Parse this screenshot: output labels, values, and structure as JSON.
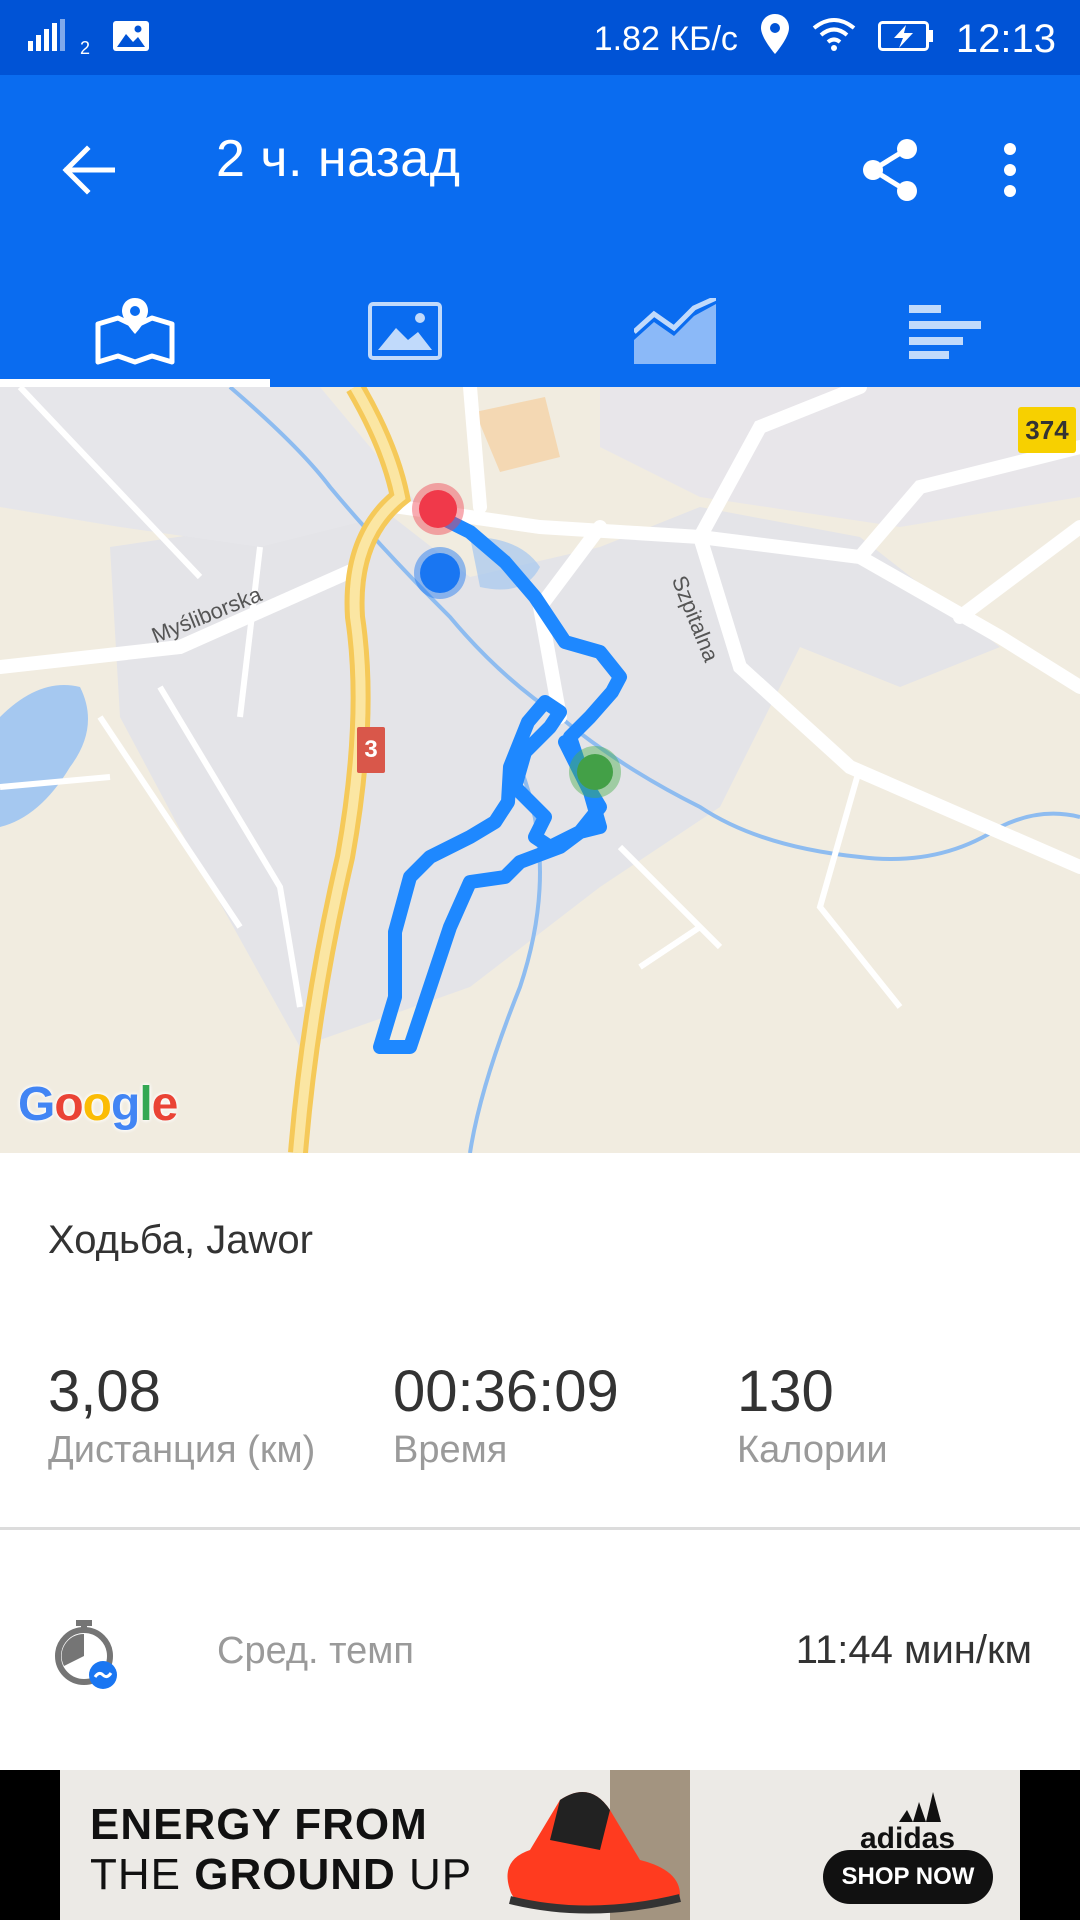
{
  "status_bar": {
    "signal_icon": "signal-bars-icon",
    "sim_label": "2",
    "gallery_icon": "image-icon",
    "speed": "1.82 КБ/с",
    "location_icon": "location-pin-icon",
    "wifi_icon": "wifi-icon",
    "battery_icon": "battery-charging-icon",
    "time": "12:13"
  },
  "app_bar": {
    "title": "2 ч. назад",
    "back_icon": "arrow-back-icon",
    "share_icon": "share-icon",
    "more_icon": "more-vert-icon",
    "color": "#0a6cf0"
  },
  "tabs": [
    {
      "icon": "map-icon",
      "active": true
    },
    {
      "icon": "photo-icon",
      "active": false
    },
    {
      "icon": "chart-icon",
      "active": false
    },
    {
      "icon": "list-icon",
      "active": false
    }
  ],
  "map": {
    "road_labels": [
      "Myśliborska",
      "Szpitalna"
    ],
    "shields": [
      "374",
      "3"
    ],
    "logo": "Google",
    "route_color": "#1e88ff",
    "start_color": "#4caf50",
    "end_color": "#ef4452",
    "marker_color": "#1976f2"
  },
  "activity": {
    "title": "Ходьба, Jawor",
    "stats": [
      {
        "value": "3,08",
        "label": "Дистанция (км)"
      },
      {
        "value": "00:36:09",
        "label": "Время"
      },
      {
        "value": "130",
        "label": "Калории"
      }
    ],
    "pace": {
      "icon": "stopwatch-icon",
      "label": "Сред. темп",
      "value": "11:44 мин/км"
    }
  },
  "ad": {
    "line1": "ENERGY FROM",
    "line2_a": "THE",
    "line2_b": "GROUND",
    "line2_c": "UP",
    "brand": "adidas",
    "cta": "SHOP NOW"
  }
}
